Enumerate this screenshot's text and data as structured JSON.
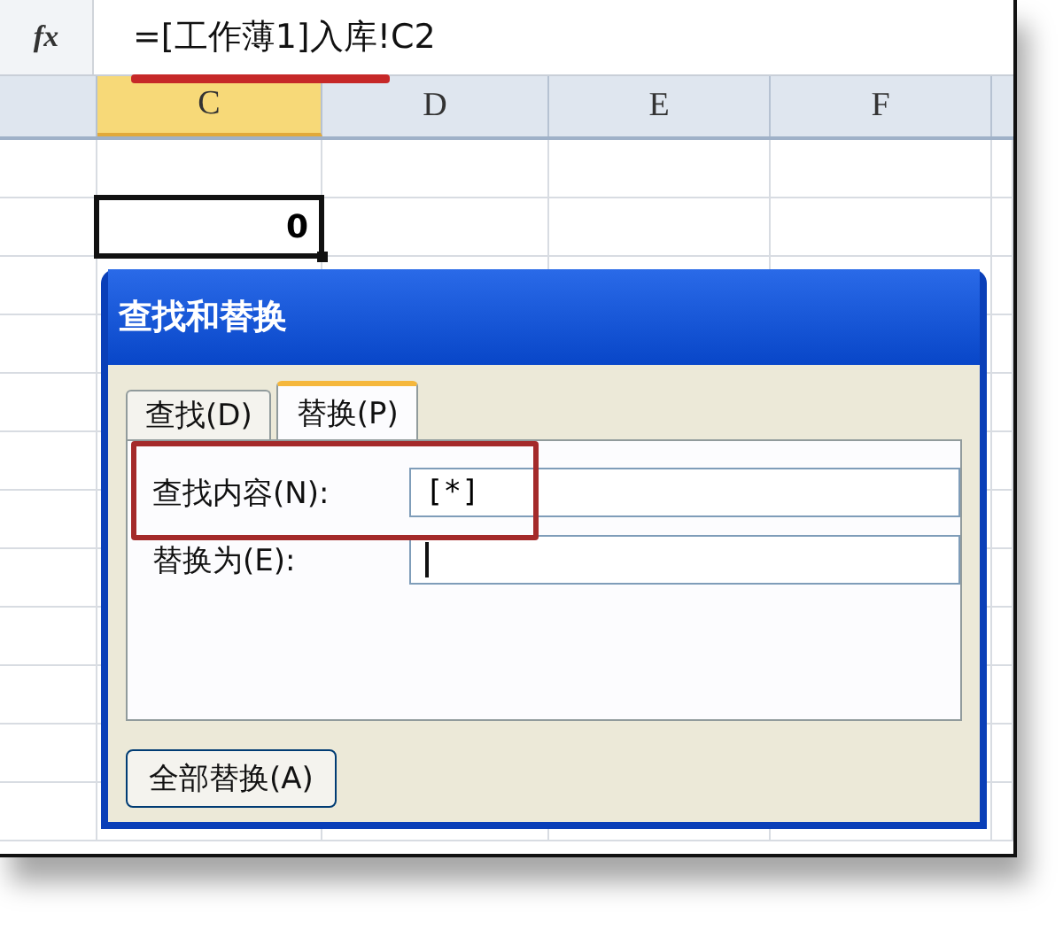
{
  "formula_bar": {
    "fx_label": "fx",
    "formula": "=[工作薄1]入库!C2"
  },
  "sheet": {
    "columns": [
      {
        "label": "C",
        "selected": true
      },
      {
        "label": "D",
        "selected": false
      },
      {
        "label": "E",
        "selected": false
      },
      {
        "label": "F",
        "selected": false
      }
    ],
    "active_cell": {
      "value": "0"
    }
  },
  "dialog": {
    "title": "查找和替换",
    "tabs": [
      {
        "label": "查找(D)",
        "selected": false
      },
      {
        "label": "替换(P)",
        "selected": true
      }
    ],
    "fields": [
      {
        "label": "查找内容(N):",
        "value": "[*]",
        "focused": false
      },
      {
        "label": "替换为(E):",
        "focused": true
      }
    ],
    "buttons": [
      "全部替换(A)"
    ]
  }
}
